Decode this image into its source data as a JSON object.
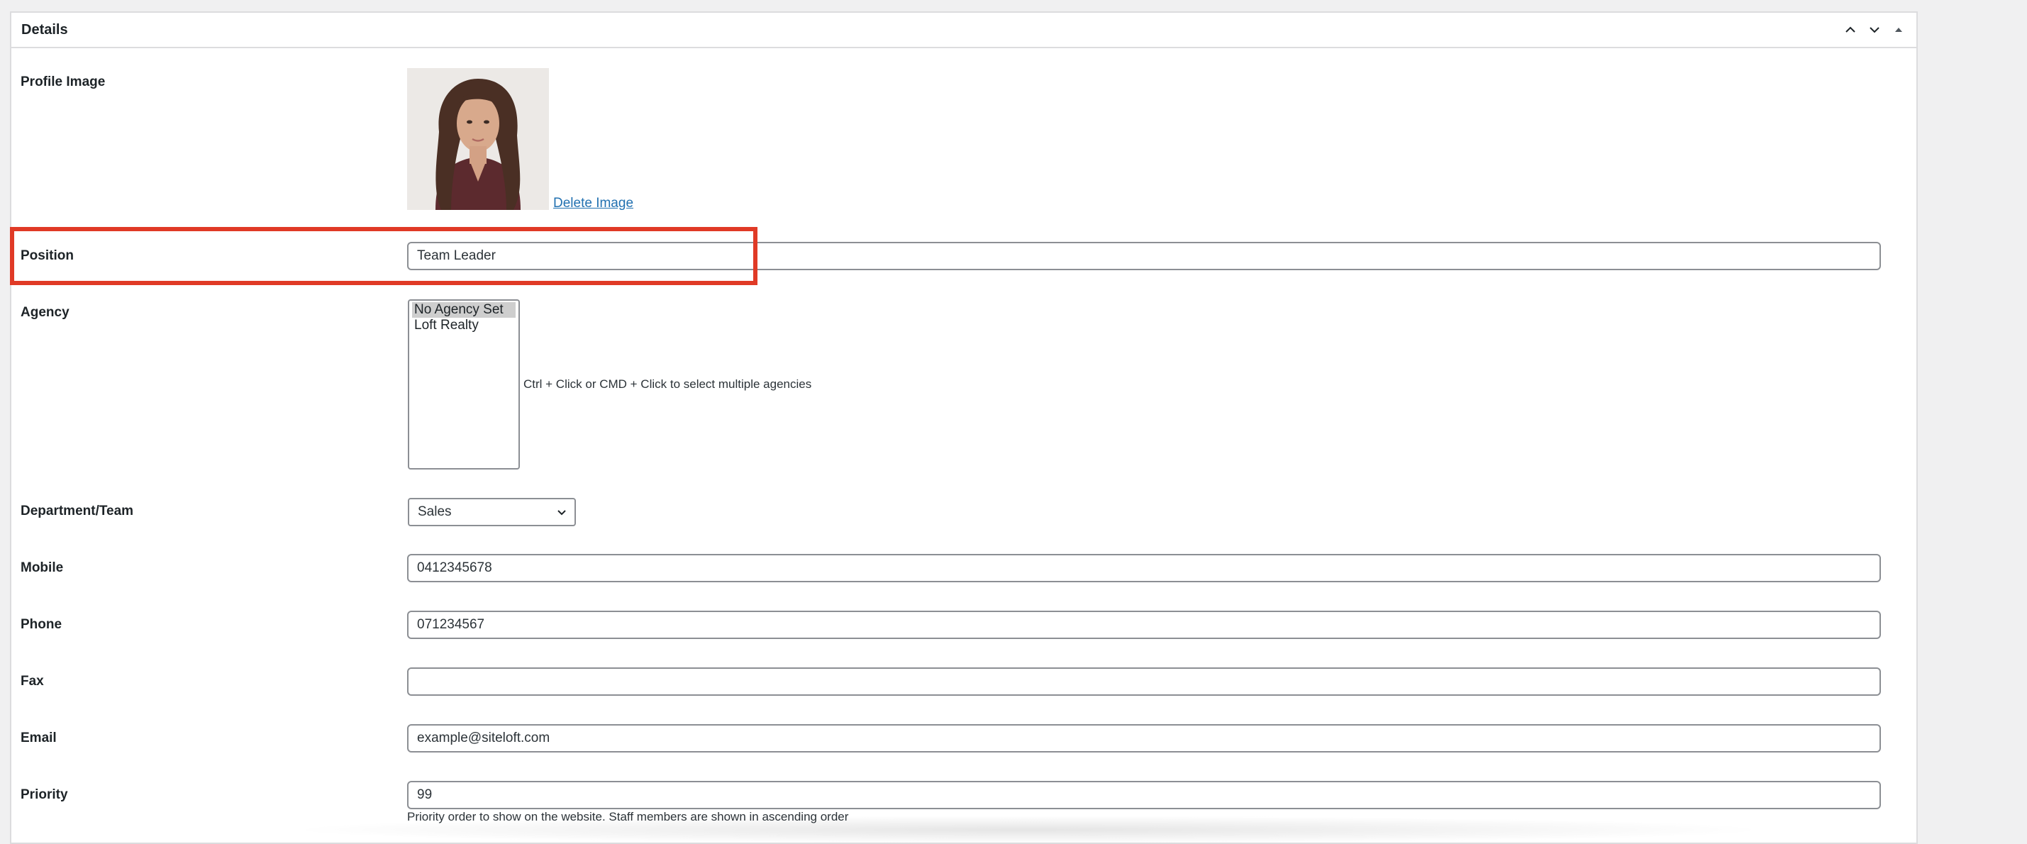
{
  "panel": {
    "title": "Details",
    "controls": [
      "chevron-up-icon",
      "chevron-down-icon",
      "triangle-up-icon"
    ]
  },
  "fields": {
    "profile_image": {
      "label": "Profile Image",
      "delete_label": "Delete Image"
    },
    "position": {
      "label": "Position",
      "value": "Team Leader"
    },
    "agency": {
      "label": "Agency",
      "options": [
        "No Agency Set",
        "Loft Realty"
      ],
      "selected": "No Agency Set",
      "help": "Ctrl + Click or CMD + Click to select multiple agencies"
    },
    "department": {
      "label": "Department/Team",
      "value": "Sales"
    },
    "mobile": {
      "label": "Mobile",
      "value": "0412345678"
    },
    "phone": {
      "label": "Phone",
      "value": "071234567"
    },
    "fax": {
      "label": "Fax",
      "value": ""
    },
    "email": {
      "label": "Email",
      "value": "example@siteloft.com"
    },
    "priority": {
      "label": "Priority",
      "value": "99",
      "help": "Priority order to show on the website. Staff members are shown in ascending order"
    }
  },
  "colors": {
    "highlight": "#e03a26",
    "link": "#2271b1",
    "border": "#8c8f94",
    "background": "#f0f0f1"
  }
}
